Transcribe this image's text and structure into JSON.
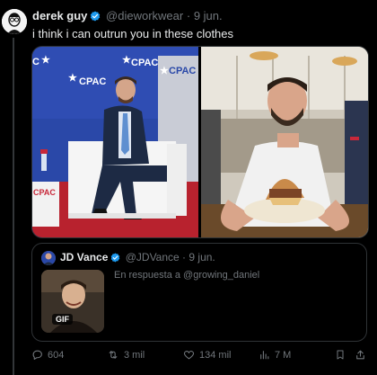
{
  "tweet": {
    "author_name": "derek guy",
    "author_handle": "@dieworkwear",
    "separator": "·",
    "date": "9 jun.",
    "text": "i think i can outrun you in these clothes"
  },
  "media": {
    "left_photo": {
      "banner_text": "CPAC"
    },
    "right_photo": {}
  },
  "quote": {
    "author_name": "JD Vance",
    "author_handle": "@JDVance",
    "separator": "·",
    "date": "9 jun.",
    "reply_text": "En respuesta a @growing_daniel",
    "gif_label": "GIF"
  },
  "actions": {
    "replies": "604",
    "retweets": "3 mil",
    "likes": "134 mil",
    "views": "7 M"
  },
  "colors": {
    "verified": "#1d9bf0",
    "muted": "#71767b",
    "cpac_blue": "#2a48a8",
    "cpac_red": "#c8283a"
  }
}
